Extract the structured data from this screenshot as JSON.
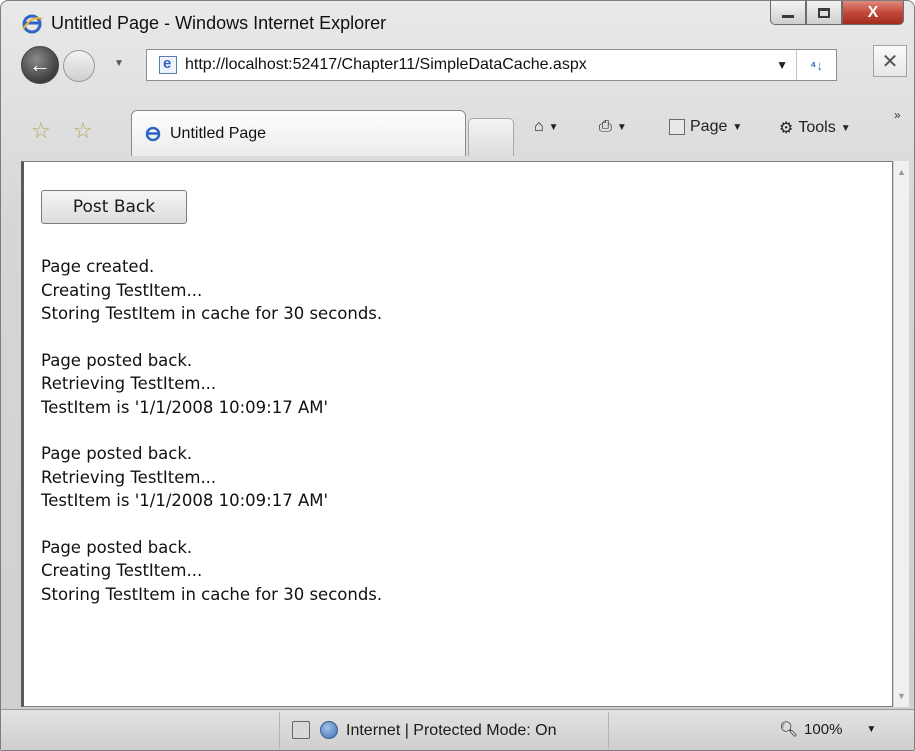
{
  "window": {
    "title": "Untitled Page - Windows Internet Explorer",
    "close_label": "X"
  },
  "navigation": {
    "back_icon": "back-arrow-icon",
    "forward_icon": "forward-arrow-icon",
    "address_url": "http://localhost:52417/Chapter11/SimpleDataCache.aspx",
    "refresh_label": "⁴↓",
    "stop_label": "✕"
  },
  "tabs": {
    "active_tab_label": "Untitled Page"
  },
  "command_bar": {
    "page_label": "Page",
    "tools_label": "Tools"
  },
  "content": {
    "postback_button_label": "Post Back",
    "log_blocks": [
      [
        "Page created.",
        "Creating TestItem...",
        "Storing TestItem in cache for 30 seconds."
      ],
      [
        "Page posted back.",
        "Retrieving TestItem...",
        "TestItem is '1/1/2008 10:09:17 AM'"
      ],
      [
        "Page posted back.",
        "Retrieving TestItem...",
        "TestItem is '1/1/2008 10:09:17 AM'"
      ],
      [
        "Page posted back.",
        "Creating TestItem...",
        "Storing TestItem in cache for 30 seconds."
      ]
    ]
  },
  "status_bar": {
    "zone_text": "Internet | Protected Mode: On",
    "zoom_level": "100%"
  },
  "colors": {
    "close_button": "#c2493a",
    "ie_blue": "#2d64c5"
  }
}
